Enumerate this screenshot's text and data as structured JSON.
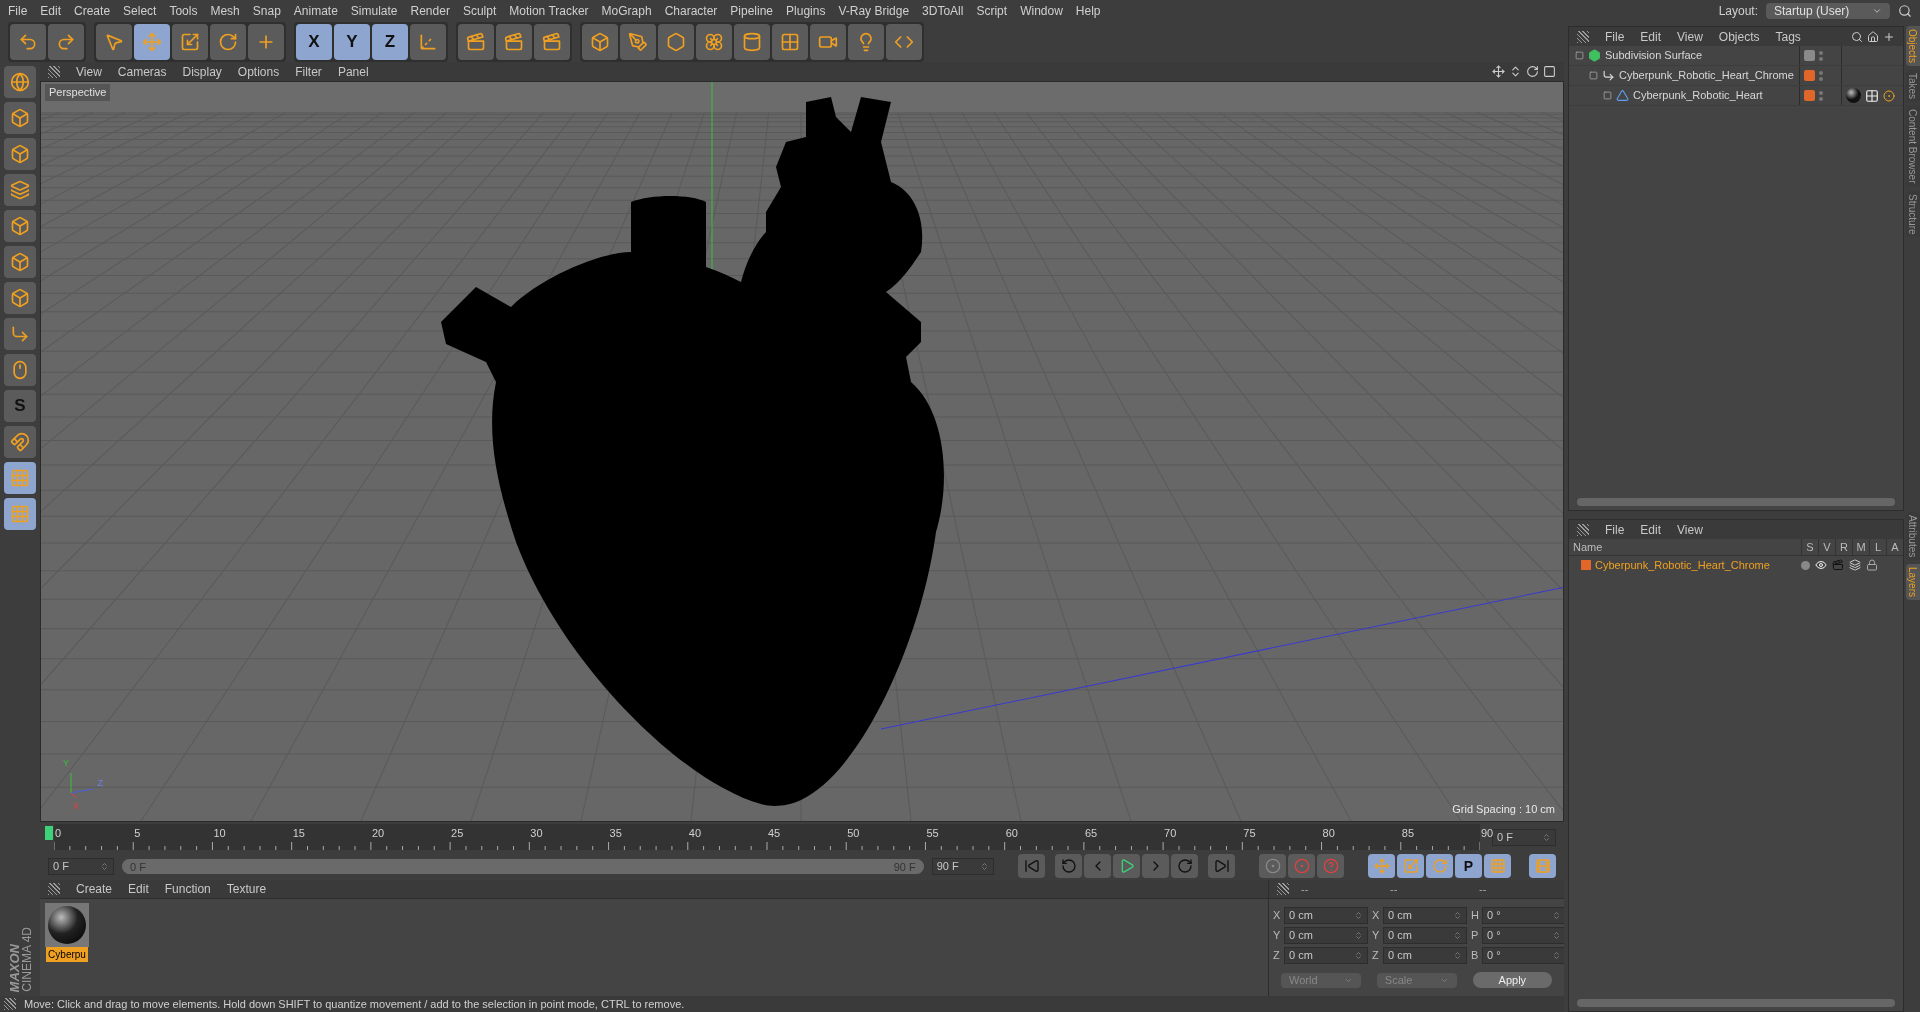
{
  "menu": [
    "File",
    "Edit",
    "Create",
    "Select",
    "Tools",
    "Mesh",
    "Snap",
    "Animate",
    "Simulate",
    "Render",
    "Sculpt",
    "Motion Tracker",
    "MoGraph",
    "Character",
    "Pipeline",
    "Plugins",
    "V-Ray Bridge",
    "3DToAll",
    "Script",
    "Window",
    "Help"
  ],
  "layout": {
    "label": "Layout:",
    "value": "Startup (User)"
  },
  "toolbar": [
    {
      "selected": false
    },
    {
      "selected": false
    },
    {
      "selected": false
    },
    {
      "selected": true
    },
    {
      "selected": false
    },
    {
      "selected": false
    },
    {
      "selected": false
    },
    {
      "label": "X",
      "selected": true
    },
    {
      "label": "Y",
      "selected": true
    },
    {
      "label": "Z",
      "selected": true
    },
    {
      "selected": false
    },
    {
      "selected": false
    },
    {
      "selected": false
    },
    {
      "selected": false
    },
    {
      "selected": false
    },
    {
      "selected": false
    },
    {
      "selected": false
    },
    {
      "selected": false
    },
    {
      "selected": false
    },
    {
      "selected": false
    },
    {
      "selected": false
    },
    {
      "selected": false
    },
    {
      "selected": false
    }
  ],
  "left_tools": [
    {
      "selected": false
    },
    {
      "selected": false
    },
    {
      "selected": false
    },
    {
      "selected": false
    },
    {
      "selected": false
    },
    {
      "selected": false
    },
    {
      "selected": false
    },
    {
      "selected": false
    },
    {
      "selected": false
    },
    {
      "label": "S",
      "selected": false
    },
    {
      "selected": false
    },
    {
      "selected": true
    },
    {
      "selected": true
    }
  ],
  "viewport": {
    "menu": [
      "View",
      "Cameras",
      "Display",
      "Options",
      "Filter",
      "Panel"
    ],
    "camera": "Perspective",
    "grid_spacing": "Grid Spacing : 10 cm",
    "axes": [
      "Y",
      "Z",
      "X"
    ]
  },
  "timeline": {
    "ticks": [
      "0",
      "5",
      "10",
      "15",
      "20",
      "25",
      "30",
      "35",
      "40",
      "45",
      "50",
      "55",
      "60",
      "65",
      "70",
      "75",
      "80",
      "85",
      "90"
    ],
    "current_frame": "0 F",
    "start": "0 F",
    "range_start": "0 F",
    "range_end": "90 F",
    "level": 1,
    "end": "90 F"
  },
  "key_tools": [
    {
      "selected": true
    },
    {
      "selected": true
    },
    {
      "selected": true
    },
    {
      "label": "P",
      "selected": true
    },
    {
      "selected": true
    },
    {
      "selected": true
    }
  ],
  "material_manager": {
    "menu": [
      "Create",
      "Edit",
      "Function",
      "Texture"
    ],
    "materials": [
      {
        "name": "Cyberpu",
        "selected": true
      }
    ]
  },
  "coordinates": {
    "headers": [
      "--",
      "--",
      "--"
    ],
    "columns": [
      [
        {
          "label": "X",
          "value": "0 cm"
        },
        {
          "label": "Y",
          "value": "0 cm"
        },
        {
          "label": "Z",
          "value": "0 cm"
        }
      ],
      [
        {
          "label": "X",
          "value": "0 cm"
        },
        {
          "label": "Y",
          "value": "0 cm"
        },
        {
          "label": "Z",
          "value": "0 cm"
        }
      ],
      [
        {
          "label": "H",
          "value": "0 °"
        },
        {
          "label": "P",
          "value": "0 °"
        },
        {
          "label": "B",
          "value": "0 °"
        }
      ]
    ],
    "dropdowns": [
      "World",
      "Scale"
    ],
    "apply": "Apply"
  },
  "logo": {
    "brand": "MAXON",
    "product": "CINEMA 4D"
  },
  "objects_panel": {
    "menu": [
      "File",
      "Edit",
      "View",
      "Objects",
      "Tags"
    ],
    "tree": [
      {
        "name": "Subdivision Surface",
        "color": "#8a8a8a",
        "children": [
          {
            "name": "Cyberpunk_Robotic_Heart_Chrome",
            "color": "#e0662a",
            "children": [
              {
                "name": "Cyberpunk_Robotic_Heart",
                "color": "#e0662a"
              }
            ]
          }
        ]
      }
    ]
  },
  "layers_panel": {
    "menu": [
      "File",
      "Edit",
      "View"
    ],
    "columns": [
      "Name",
      "S",
      "V",
      "R",
      "M",
      "L",
      "A"
    ],
    "rows": [
      {
        "name": "Cyberpunk_Robotic_Heart_Chrome",
        "color": "#e0662a"
      }
    ]
  },
  "side_tabs_top": [
    {
      "label": "Objects",
      "selected": true
    },
    {
      "label": "Takes",
      "selected": false
    },
    {
      "label": "Content Browser",
      "selected": false
    },
    {
      "label": "Structure",
      "selected": false
    }
  ],
  "side_tabs_bottom": [
    {
      "label": "Attributes",
      "selected": false
    },
    {
      "label": "Layers",
      "selected": true
    }
  ],
  "status_bar": "Move: Click and drag to move elements. Hold down SHIFT to quantize movement / add to the selection in point mode, CTRL to remove."
}
